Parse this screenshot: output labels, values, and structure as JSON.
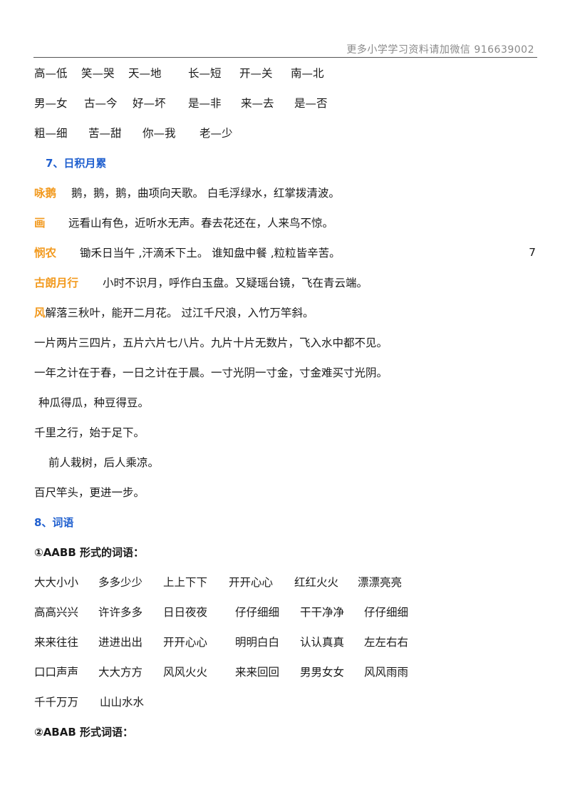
{
  "header": {
    "text": "更多小学学习资料请加微信 916639002"
  },
  "antonym_rows": [
    [
      "高—低",
      "笑—哭",
      "天—地",
      "长—短",
      "开—关",
      "南—北"
    ],
    [
      "男—女",
      "古—今",
      "好—坏",
      "是—非",
      "来—去",
      "是—否"
    ],
    [
      "粗—细",
      "苦—甜",
      "你—我",
      "老—少"
    ]
  ],
  "section7": {
    "heading": "7、日积月累"
  },
  "poems": [
    {
      "title": "咏鹅",
      "text": "鹅，鹅，鹅，曲项向天歌。    白毛浮绿水，红掌拨清波。"
    },
    {
      "title": "画",
      "text": "远看山有色，近听水无声。春去花还在，人来鸟不惊。"
    },
    {
      "title": "悯农",
      "text": "锄禾日当午 ,汗滴禾下土。 谁知盘中餐 ,粒粒皆辛苦。"
    },
    {
      "title": "古朗月行",
      "text": "小时不识月，呼作白玉盘。又疑瑶台镜，飞在青云端。"
    },
    {
      "title": "风",
      "text": "解落三秋叶，能开二月花。    过江千尺浪，入竹万竿斜。"
    }
  ],
  "page_number": "7",
  "sayings": [
    "一片两片三四片，五片六片七八片。九片十片无数片，飞入水中都不见。",
    "一年之计在于春，一日之计在于晨。一寸光阴一寸金，寸金难买寸光阴。",
    "种瓜得瓜，种豆得豆。",
    "千里之行，始于足下。",
    "前人栽树，后人乘凉。",
    "百尺竿头，更进一步。"
  ],
  "section8": {
    "heading": "8、词语",
    "sub1": "①AABB 形式的词语：",
    "sub2": "②ABAB 形式词语："
  },
  "aabb_rows": [
    [
      "大大小小",
      "多多少少",
      "上上下下",
      "开开心心",
      "红红火火",
      "漂漂亮亮"
    ],
    [
      "高高兴兴",
      "许许多多",
      "日日夜夜",
      "仔仔细细",
      "干干净净",
      "仔仔细细"
    ],
    [
      "来来往往",
      "进进出出",
      "开开心心",
      "明明白白",
      "认认真真",
      "左左右右"
    ],
    [
      "口口声声",
      "大大方方",
      "风风火火",
      "来来回回",
      "男男女女",
      "风风雨雨"
    ],
    [
      "千千万万",
      "山山水水"
    ]
  ],
  "colors": {
    "heading_blue": "#1f5fcf",
    "poem_title_orange": "#f29a1f",
    "header_gray": "#8a8a8a"
  }
}
